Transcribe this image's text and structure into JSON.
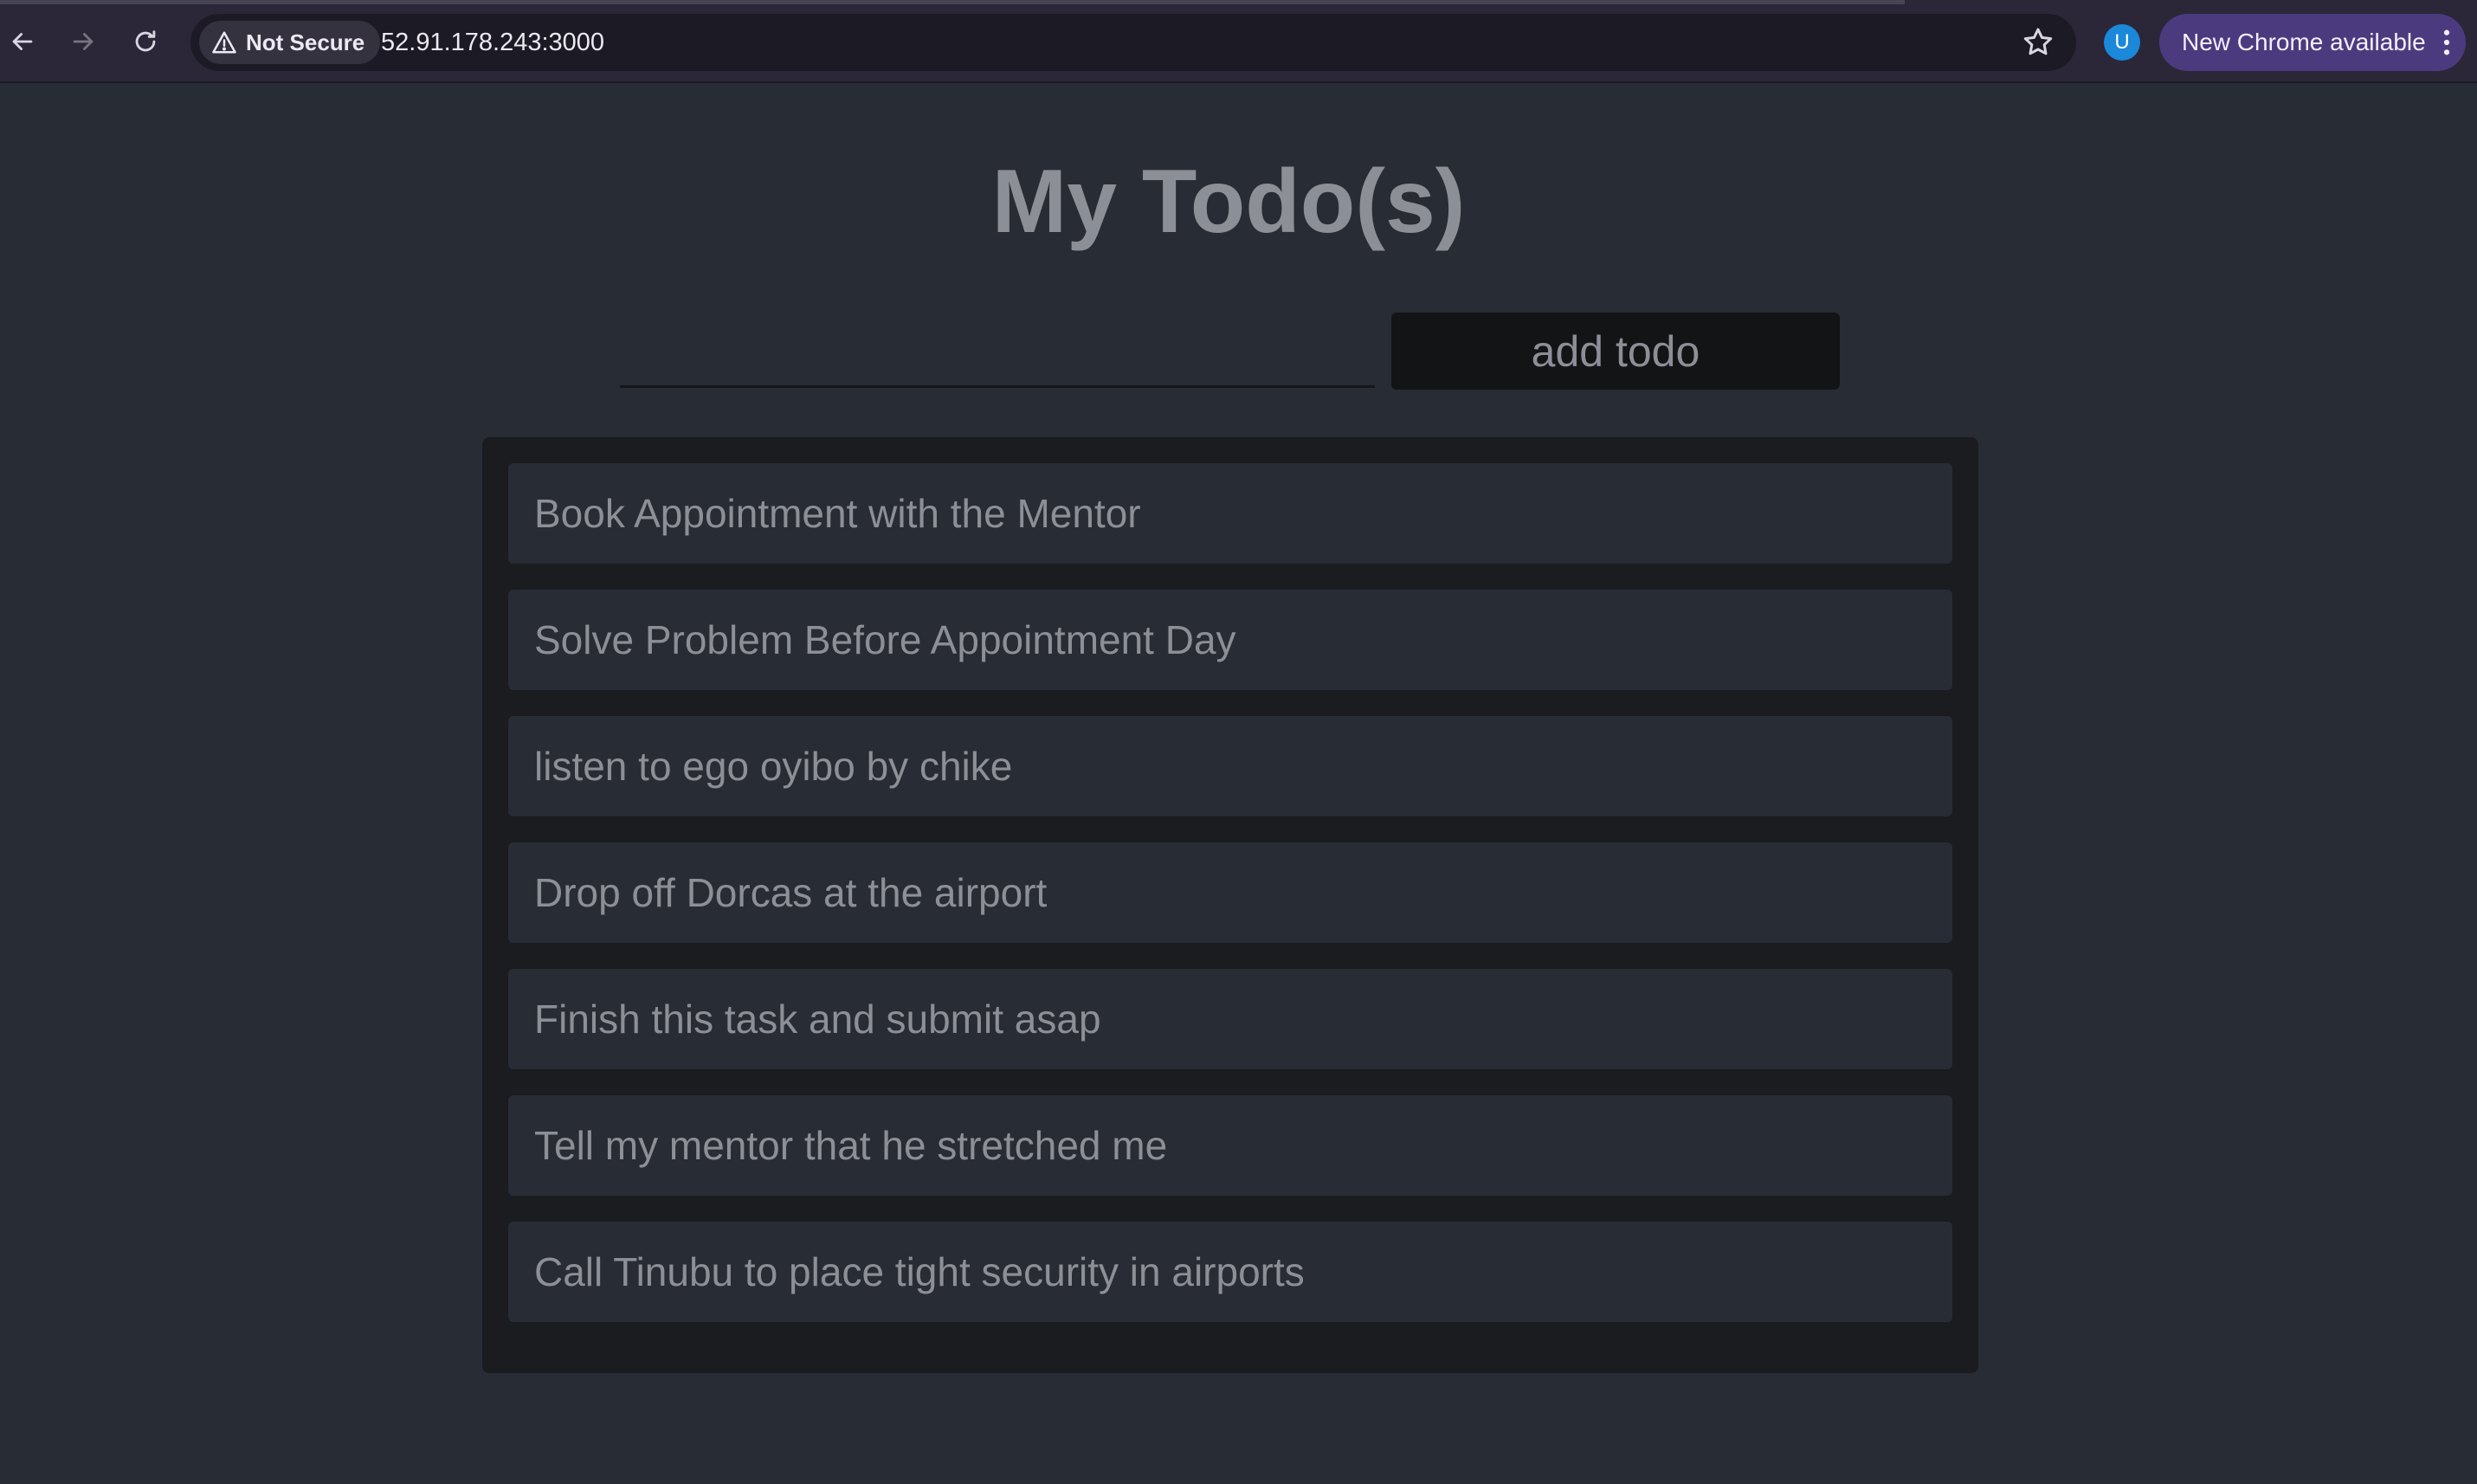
{
  "browser": {
    "security_label": "Not Secure",
    "url": "52.91.178.243:3000",
    "profile_initial": "U",
    "update_label": "New Chrome available",
    "icons": [
      "back-arrow-icon",
      "forward-arrow-icon",
      "reload-icon",
      "warning-triangle-icon",
      "star-icon",
      "kebab-menu-icon"
    ]
  },
  "page": {
    "title": "My Todo(s)",
    "input": {
      "value": "",
      "placeholder": ""
    },
    "add_button_label": "add todo",
    "todos": [
      "Book Appointment with the Mentor",
      "Solve Problem Before Appointment Day",
      "listen to ego oyibo by chike",
      "Drop off Dorcas at the airport",
      "Finish this task and submit asap",
      "Tell my mentor that he stretched me",
      "Call Tinubu to place tight security in airports"
    ]
  },
  "colors": {
    "page_background": "#282c34",
    "panel_background": "#1a1c20",
    "text": "#8c8f96",
    "button_background": "#131416",
    "chrome_background": "#2b2738",
    "update_chip": "#4c3a7e",
    "avatar": "#1b88d9"
  }
}
